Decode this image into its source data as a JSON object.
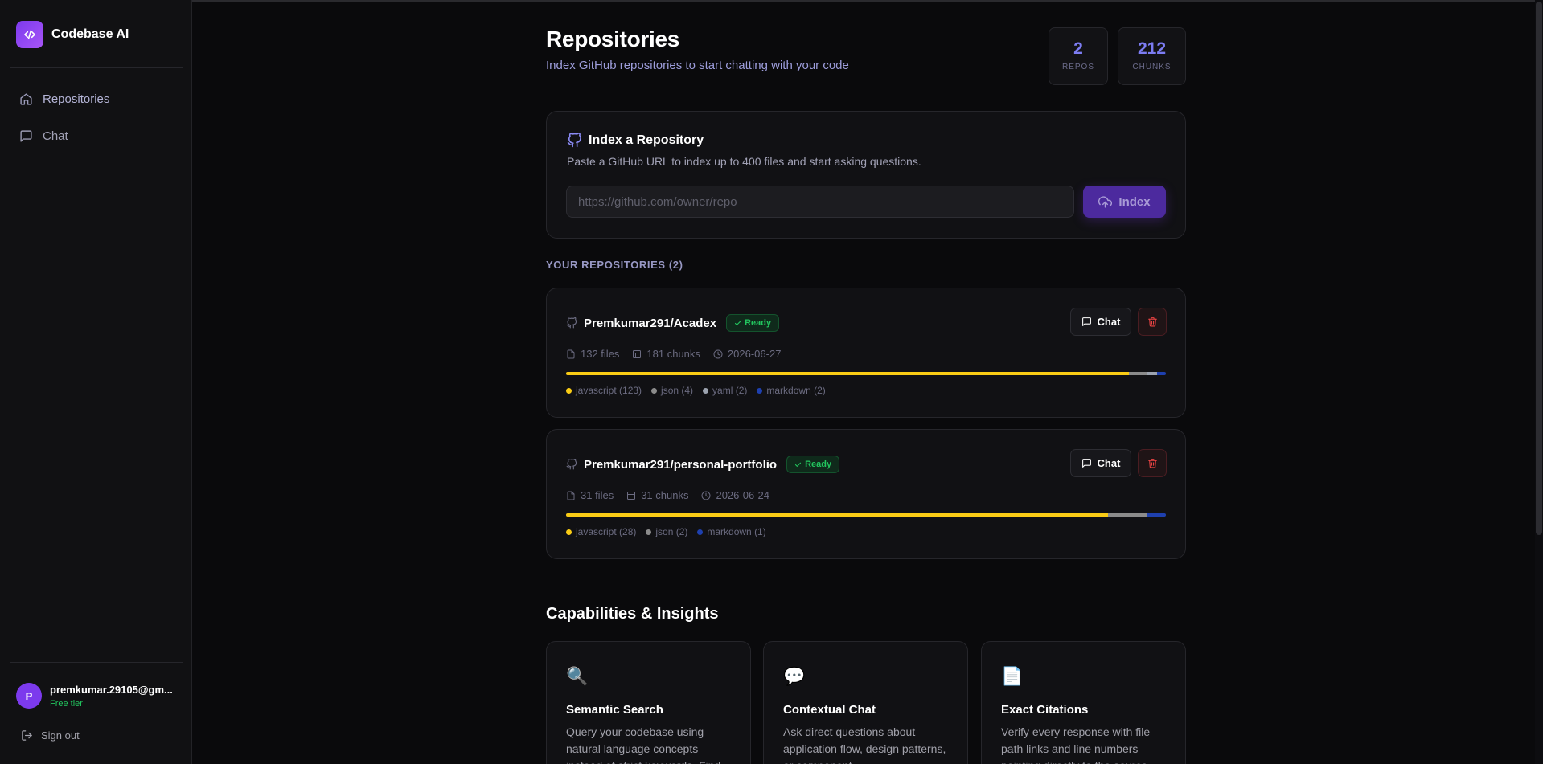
{
  "app": {
    "name": "Codebase AI"
  },
  "sidebar": {
    "items": [
      {
        "label": "Repositories",
        "icon": "home-icon"
      },
      {
        "label": "Chat",
        "icon": "message-square-icon"
      }
    ],
    "user": {
      "initial": "P",
      "email": "premkumar.29105@gm...",
      "tier": "Free tier"
    },
    "sign_out": "Sign out"
  },
  "header": {
    "title": "Repositories",
    "subtitle": "Index GitHub repositories to start chatting with your code",
    "stats": [
      {
        "value": "2",
        "label": "REPOS"
      },
      {
        "value": "212",
        "label": "CHUNKS"
      }
    ]
  },
  "index_card": {
    "title": "Index a Repository",
    "description": "Paste a GitHub URL to index up to 400 files and start asking questions.",
    "placeholder": "https://github.com/owner/repo",
    "value": "",
    "button_label": "Index"
  },
  "repos_section": {
    "label": "YOUR REPOSITORIES (2)"
  },
  "repos": [
    {
      "name": "Premkumar291/Acadex",
      "status": "Ready",
      "files": "132 files",
      "chunks": "181 chunks",
      "date": "2026-06-27",
      "chat_label": "Chat",
      "languages": [
        {
          "label": "javascript (123)",
          "count": 123,
          "color": "#facc15"
        },
        {
          "label": "json (4)",
          "count": 4,
          "color": "#8b8b8b"
        },
        {
          "label": "yaml (2)",
          "count": 2,
          "color": "#9ca3af"
        },
        {
          "label": "markdown (2)",
          "count": 2,
          "color": "#1e40af"
        }
      ]
    },
    {
      "name": "Premkumar291/personal-portfolio",
      "status": "Ready",
      "files": "31 files",
      "chunks": "31 chunks",
      "date": "2026-06-24",
      "chat_label": "Chat",
      "languages": [
        {
          "label": "javascript (28)",
          "count": 28,
          "color": "#facc15"
        },
        {
          "label": "json (2)",
          "count": 2,
          "color": "#8b8b8b"
        },
        {
          "label": "markdown (1)",
          "count": 1,
          "color": "#1e40af"
        }
      ]
    }
  ],
  "capabilities": {
    "title": "Capabilities & Insights",
    "items": [
      {
        "icon": "🔍",
        "title": "Semantic Search",
        "description": "Query your codebase using natural language concepts instead of strict keywords. Find"
      },
      {
        "icon": "💬",
        "title": "Contextual Chat",
        "description": "Ask direct questions about application flow, design patterns, or component"
      },
      {
        "icon": "📄",
        "title": "Exact Citations",
        "description": "Verify every response with file path links and line numbers pointing directly to the source"
      }
    ]
  },
  "colors": {
    "accent": "#7c3aed",
    "ready": "#22c55e",
    "danger": "#ef4444"
  }
}
